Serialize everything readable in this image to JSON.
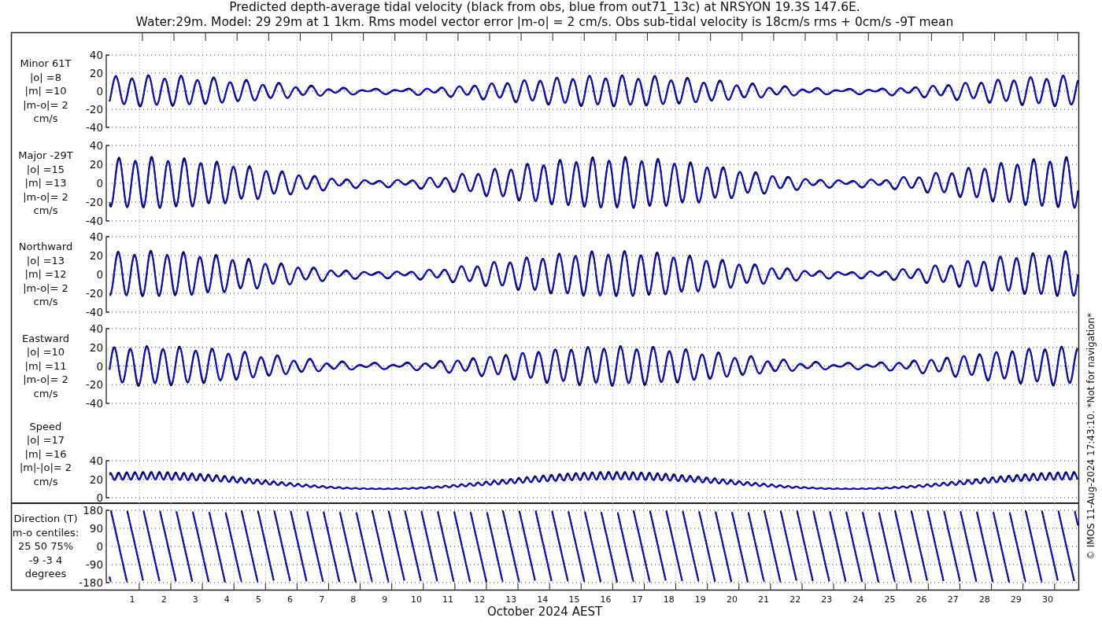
{
  "title_lines": [
    "Predicted depth-average tidal velocity (black from obs, blue from out71_13c) at NRSYON 19.3S 147.6E.",
    "Water:29m. Model: 29 29m at 1 1km. Rms model vector error |m-o| = 2 cm/s. Obs sub-tidal velocity is 18cm/s rms + 0cm/s -9T mean"
  ],
  "panels": [
    {
      "kind": "velocity",
      "label_lines": [
        "Minor 61T",
        "|o| =8",
        "|m| =10",
        "|m-o|= 2",
        "cm/s"
      ],
      "yticks": [
        "40",
        "20",
        "0",
        "-20",
        "-40"
      ]
    },
    {
      "kind": "velocity",
      "label_lines": [
        "Major -29T",
        "|o| =15",
        "|m| =13",
        "|m-o|= 2",
        "cm/s"
      ],
      "yticks": [
        "40",
        "20",
        "0",
        "-20",
        "-40"
      ]
    },
    {
      "kind": "velocity",
      "label_lines": [
        "Northward",
        "|o| =13",
        "|m| =12",
        "|m-o|= 2",
        "cm/s"
      ],
      "yticks": [
        "40",
        "20",
        "0",
        "-20",
        "-40"
      ]
    },
    {
      "kind": "velocity",
      "label_lines": [
        "Eastward",
        "|o| =10",
        "|m| =11",
        "|m-o|= 2",
        "cm/s"
      ],
      "yticks": [
        "40",
        "20",
        "0",
        "-20",
        "-40"
      ]
    },
    {
      "kind": "speed",
      "label_lines": [
        "Speed",
        "|o| =17",
        "|m| =16",
        "|m|-|o|= 2",
        "cm/s"
      ],
      "yticks": [
        "40",
        "20",
        "0"
      ]
    },
    {
      "kind": "direction",
      "label_lines": [
        "Direction (T)",
        "m-o centiles:",
        "25  50  75%",
        "-9 -3  4",
        "degrees"
      ],
      "yticks": [
        "180",
        "90",
        "0",
        "-90",
        "-180"
      ]
    }
  ],
  "xtick_labels": [
    "1",
    "2",
    "3",
    "4",
    "5",
    "6",
    "7",
    "8",
    "9",
    "10",
    "11",
    "12",
    "13",
    "14",
    "15",
    "16",
    "17",
    "18",
    "19",
    "20",
    "21",
    "22",
    "23",
    "24",
    "25",
    "26",
    "27",
    "28",
    "29",
    "30"
  ],
  "xlabel": "October 2024 AEST",
  "credit": "© IMOS 11-Aug-2024 17:43:10. *Not for navigation*"
}
